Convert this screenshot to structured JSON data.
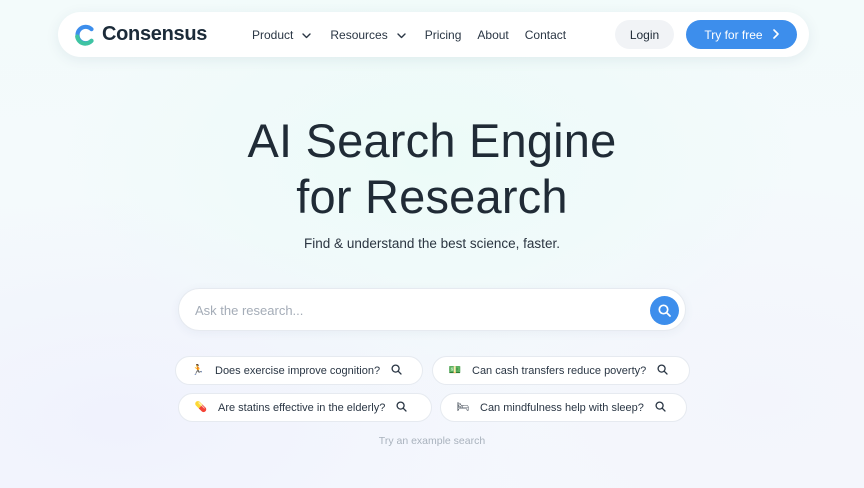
{
  "nav": {
    "brand": "Consensus",
    "links": [
      {
        "label": "Product",
        "dropdown": true
      },
      {
        "label": "Resources",
        "dropdown": true
      },
      {
        "label": "Pricing",
        "dropdown": false
      },
      {
        "label": "About",
        "dropdown": false
      },
      {
        "label": "Contact",
        "dropdown": false
      }
    ],
    "login_label": "Login",
    "cta_label": "Try for free"
  },
  "hero": {
    "title_line1": "AI Search Engine",
    "title_line2": "for Research",
    "subtitle": "Find & understand the best science, faster."
  },
  "search": {
    "placeholder": "Ask the research...",
    "value": ""
  },
  "examples": [
    {
      "emoji": "🏃",
      "label": "Does exercise improve cognition?"
    },
    {
      "emoji": "💵",
      "label": "Can cash transfers reduce poverty?"
    },
    {
      "emoji": "💊",
      "label": "Are statins effective in the elderly?"
    },
    {
      "emoji": "🛏",
      "label": "Can mindfulness help with sleep?"
    }
  ],
  "hint": "Try an example search",
  "colors": {
    "accent": "#3d8eec",
    "logo_green": "#3fc4a2",
    "logo_blue": "#3d8eec"
  }
}
